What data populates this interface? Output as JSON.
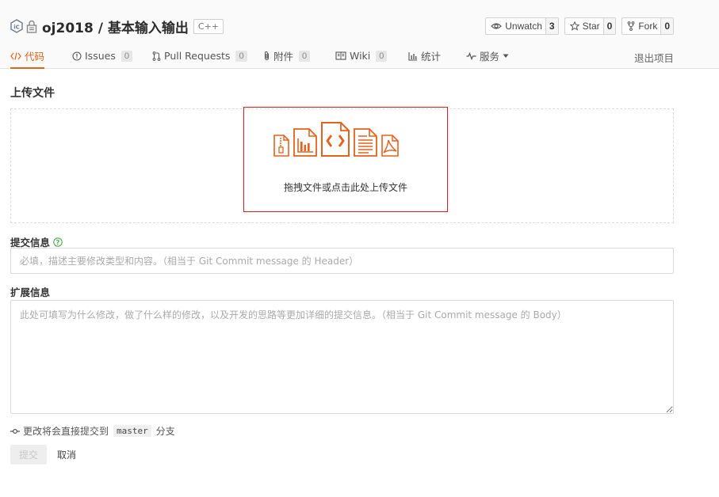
{
  "header": {
    "owner": "oj2018",
    "separator": "/",
    "repo_name": "基本输入输出",
    "language": "C++",
    "icons": [
      "project-logo-icon",
      "lock-icon"
    ]
  },
  "actions": [
    {
      "id": "watch",
      "icon": "eye-icon",
      "label": "Unwatch",
      "count": "3"
    },
    {
      "id": "star",
      "icon": "star-icon",
      "label": "Star",
      "count": "0"
    },
    {
      "id": "fork",
      "icon": "fork-icon",
      "label": "Fork",
      "count": "0"
    }
  ],
  "tabs": [
    {
      "label": "代码",
      "icon": "code-icon",
      "badge": ""
    },
    {
      "label": "Issues",
      "icon": "issue-icon",
      "badge": "0"
    },
    {
      "label": "Pull Requests",
      "icon": "pull-request-icon",
      "badge": "0"
    },
    {
      "label": "附件",
      "icon": "paperclip-icon",
      "badge": "0"
    },
    {
      "label": "Wiki",
      "icon": "book-icon",
      "badge": "0"
    },
    {
      "label": "统计",
      "icon": "bar-chart-icon",
      "badge": ""
    },
    {
      "label": "服务",
      "icon": "pulse-icon",
      "badge": ""
    }
  ],
  "exit_link": "退出项目",
  "upload": {
    "title": "上传文件",
    "hint": "拖拽文件或点击此处上传文件",
    "icons": [
      "zip-file-icon",
      "chart-file-icon",
      "code-file-icon",
      "text-file-icon",
      "pdf-file-icon"
    ]
  },
  "commit": {
    "label": "提交信息",
    "placeholder": "必填，描述主要修改类型和内容。（相当于 Git Commit message 的 Header）",
    "value": ""
  },
  "extended": {
    "label": "扩展信息",
    "placeholder": "此处可填写为什么修改，做了什么样的修改，以及开发的思路等更加详细的提交信息。（相当于 Git Commit message 的 Body）",
    "value": ""
  },
  "branch_note": {
    "prefix": "更改将会直接提交到",
    "branch": "master",
    "suffix": "分支"
  },
  "buttons": {
    "submit": "提交",
    "cancel": "取消"
  },
  "colors": {
    "accent": "#e4621b",
    "highlight_border": "#e01e1e",
    "help_icon": "#4cae4c"
  }
}
